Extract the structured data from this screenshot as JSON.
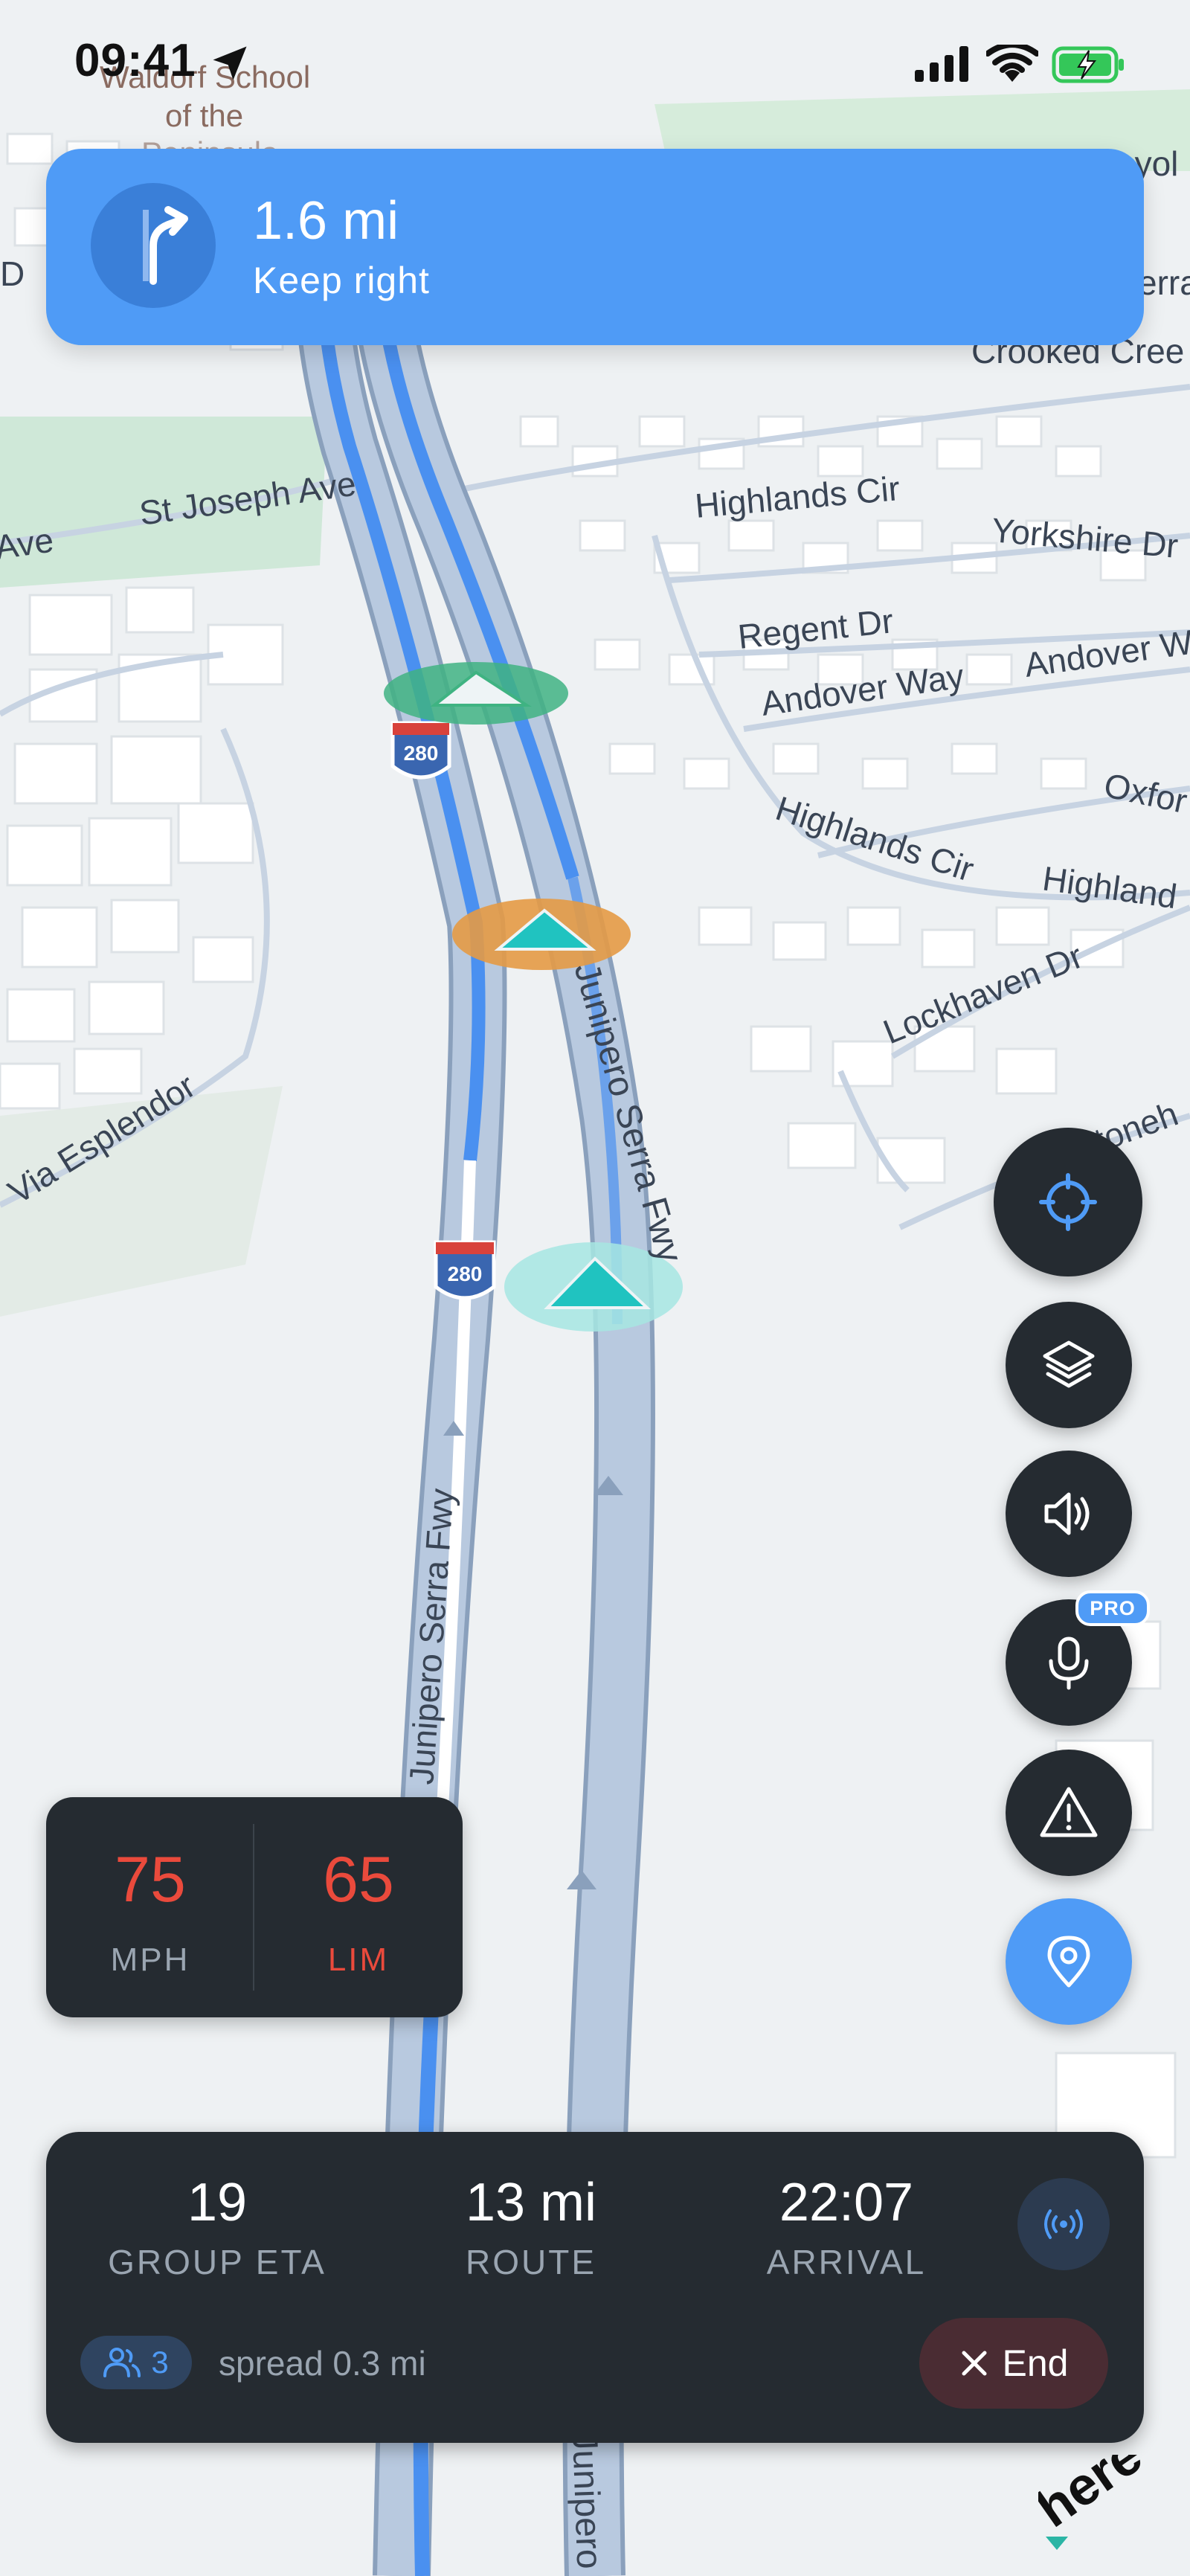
{
  "status_bar": {
    "time": "09:41"
  },
  "map": {
    "place_labels": [
      "Waldorf School",
      "of the",
      "Crooked Cree",
      "St Joseph Ave",
      "Ave",
      "Highlands Cir",
      "Yorkshire Dr",
      "Regent Dr",
      "Andover Way",
      "Andover W",
      "Oxfor",
      "Highlands Cir",
      "Highland",
      "Lockhaven Dr",
      "Stoneh",
      "Via Esplendor",
      "Junipero Serra Fwy",
      "Junipero Serra Fwy",
      "Junipero",
      "Peninsula",
      "ayol",
      "erra",
      "D"
    ],
    "shields": [
      "280",
      "280",
      "280"
    ]
  },
  "nav_banner": {
    "distance": "1.6 mi",
    "instruction": "Keep right",
    "icon": "keep-right-arrow"
  },
  "speed": {
    "current": "75",
    "current_unit": "MPH",
    "limit": "65",
    "limit_unit": "LIM"
  },
  "side_buttons": [
    "recenter-icon",
    "layers-icon",
    "volume-icon",
    "microphone-icon",
    "warning-icon",
    "location-pin-icon"
  ],
  "pro_badge": "PRO",
  "trip": {
    "group_eta_value": "19",
    "group_eta_label": "GROUP ETA",
    "route_value": "13 mi",
    "route_label": "ROUTE",
    "arrival_value": "22:07",
    "arrival_label": "ARRIVAL",
    "group_count": "3",
    "spread": "spread 0.3 mi",
    "end_label": "End"
  },
  "logo": "here",
  "colors": {
    "accent": "#4f9bf6",
    "panel": "#252b31",
    "speed_red": "#ea4a3c",
    "route_blue": "#4a90f0",
    "marker_green": "#3fb382",
    "marker_orange": "#e49a45",
    "marker_teal": "#20c3c0"
  }
}
